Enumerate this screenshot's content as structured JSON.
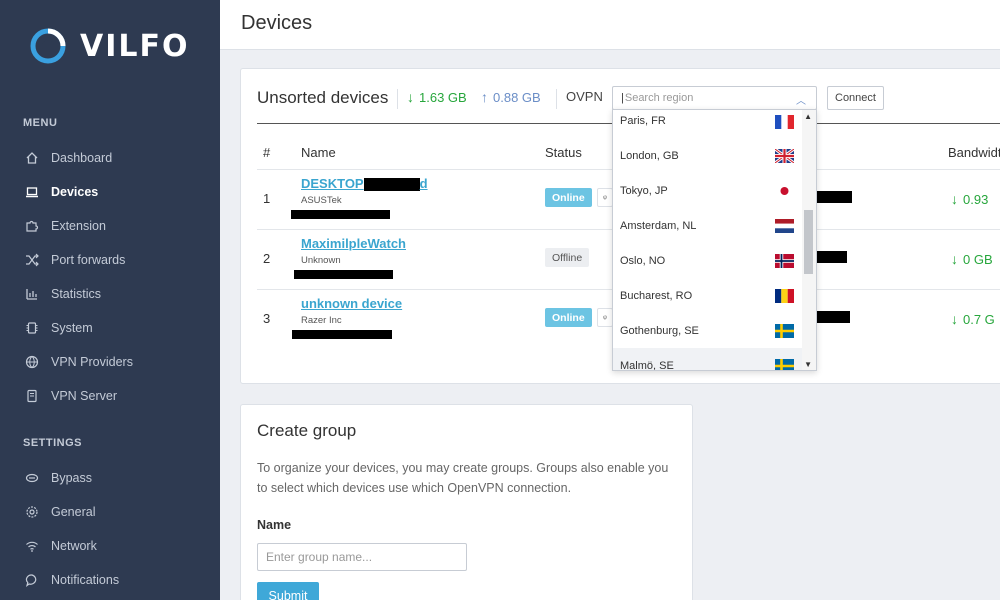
{
  "app": {
    "logo_text": "VILFO"
  },
  "sidebar": {
    "menu_label": "MENU",
    "menu_items": [
      {
        "label": "Dashboard",
        "icon": "home-icon"
      },
      {
        "label": "Devices",
        "icon": "laptop-icon",
        "active": true
      },
      {
        "label": "Extension",
        "icon": "puzzle-icon"
      },
      {
        "label": "Port forwards",
        "icon": "shuffle-icon"
      },
      {
        "label": "Statistics",
        "icon": "bar-chart-icon"
      },
      {
        "label": "System",
        "icon": "chip-icon"
      },
      {
        "label": "VPN Providers",
        "icon": "globe-icon"
      },
      {
        "label": "VPN Server",
        "icon": "server-icon"
      }
    ],
    "settings_label": "SETTINGS",
    "settings_items": [
      {
        "label": "Bypass",
        "icon": "bypass-icon"
      },
      {
        "label": "General",
        "icon": "gear-icon"
      },
      {
        "label": "Network",
        "icon": "wifi-icon"
      },
      {
        "label": "Notifications",
        "icon": "chat-icon"
      }
    ]
  },
  "header": {
    "title": "Devices"
  },
  "devices_card": {
    "title": "Unsorted devices",
    "download": "1.63 GB",
    "upload": "0.88 GB",
    "protocol": "OVPN",
    "search_placeholder": "Search region",
    "connect_label": "Connect",
    "columns": [
      "#",
      "Name",
      "Status",
      "Bandwidt"
    ],
    "rows": [
      {
        "num": "1",
        "name": "DESKTOP",
        "vendor": "ASUSTek",
        "status": "Online",
        "bandwidth": "0.93"
      },
      {
        "num": "2",
        "name": "MaximilpleWatch",
        "vendor": "Unknown",
        "status": "Offline",
        "bandwidth": "0 GB"
      },
      {
        "num": "3",
        "name": "unknown device",
        "vendor": "Razer Inc",
        "status": "Online",
        "bandwidth": "0.7 G"
      }
    ]
  },
  "region_dropdown": {
    "items": [
      {
        "label": "Paris, FR",
        "flag": "fr"
      },
      {
        "label": "London, GB",
        "flag": "gb"
      },
      {
        "label": "Tokyo, JP",
        "flag": "jp"
      },
      {
        "label": "Amsterdam, NL",
        "flag": "nl"
      },
      {
        "label": "Oslo, NO",
        "flag": "no"
      },
      {
        "label": "Bucharest, RO",
        "flag": "ro"
      },
      {
        "label": "Gothenburg, SE",
        "flag": "se"
      },
      {
        "label": "Malmö, SE",
        "flag": "se"
      }
    ]
  },
  "create_group": {
    "title": "Create group",
    "description": "To organize your devices, you may create groups. Groups also enable you to select which devices use which OpenVPN connection.",
    "name_label": "Name",
    "name_placeholder": "Enter group name...",
    "submit_label": "Submit"
  },
  "colors": {
    "sidebar_bg": "#2e3a51",
    "accent": "#3fa8d8",
    "online": "#6cc4e3",
    "download_green": "#27a63c",
    "upload_blue": "#6b8ec7"
  }
}
